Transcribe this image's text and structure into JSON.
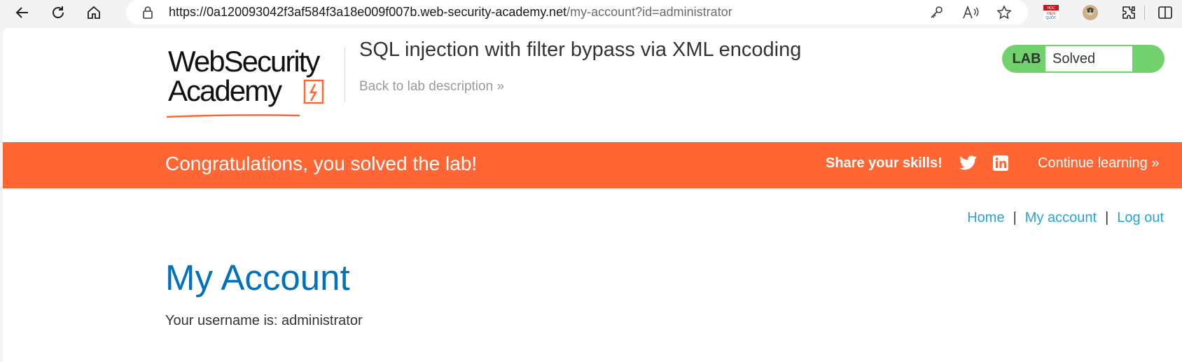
{
  "browser": {
    "url_host": "https://0a120093042f3af584f3a18e009f007b.web-security-academy.net",
    "url_path": "/my-account?id=administrator",
    "icons": [
      "back-icon",
      "refresh-icon",
      "home-icon",
      "lock-icon",
      "key-icon",
      "read-aloud-icon",
      "favorite-star-icon",
      "extension-flag-icon",
      "profile-avatar-icon",
      "extensions-puzzle-icon",
      "split-screen-icon"
    ],
    "flag_text": [
      "HỌC",
      "HIỂN",
      "QUỐC"
    ]
  },
  "header": {
    "logo_line1": "WebSecurity",
    "logo_line2": "Academy",
    "lab_title": "SQL injection with filter bypass via XML encoding",
    "back_link": "Back to lab description",
    "back_chevrons": "»",
    "lab_label": "LAB",
    "lab_status": "Solved"
  },
  "banner": {
    "congrats": "Congratulations, you solved the lab!",
    "share": "Share your skills!",
    "continue": "Continue learning",
    "continue_chevrons": "»"
  },
  "nav": {
    "home": "Home",
    "sep1": "|",
    "my_account": "My account",
    "sep2": "|",
    "log_out": "Log out"
  },
  "main": {
    "heading": "My Account",
    "username_text": "Your username is: administrator"
  },
  "colors": {
    "brand_orange": "#ff6633",
    "solved_green": "#70d16d",
    "link_blue": "#29a3d6",
    "heading_blue": "#0071bc"
  }
}
